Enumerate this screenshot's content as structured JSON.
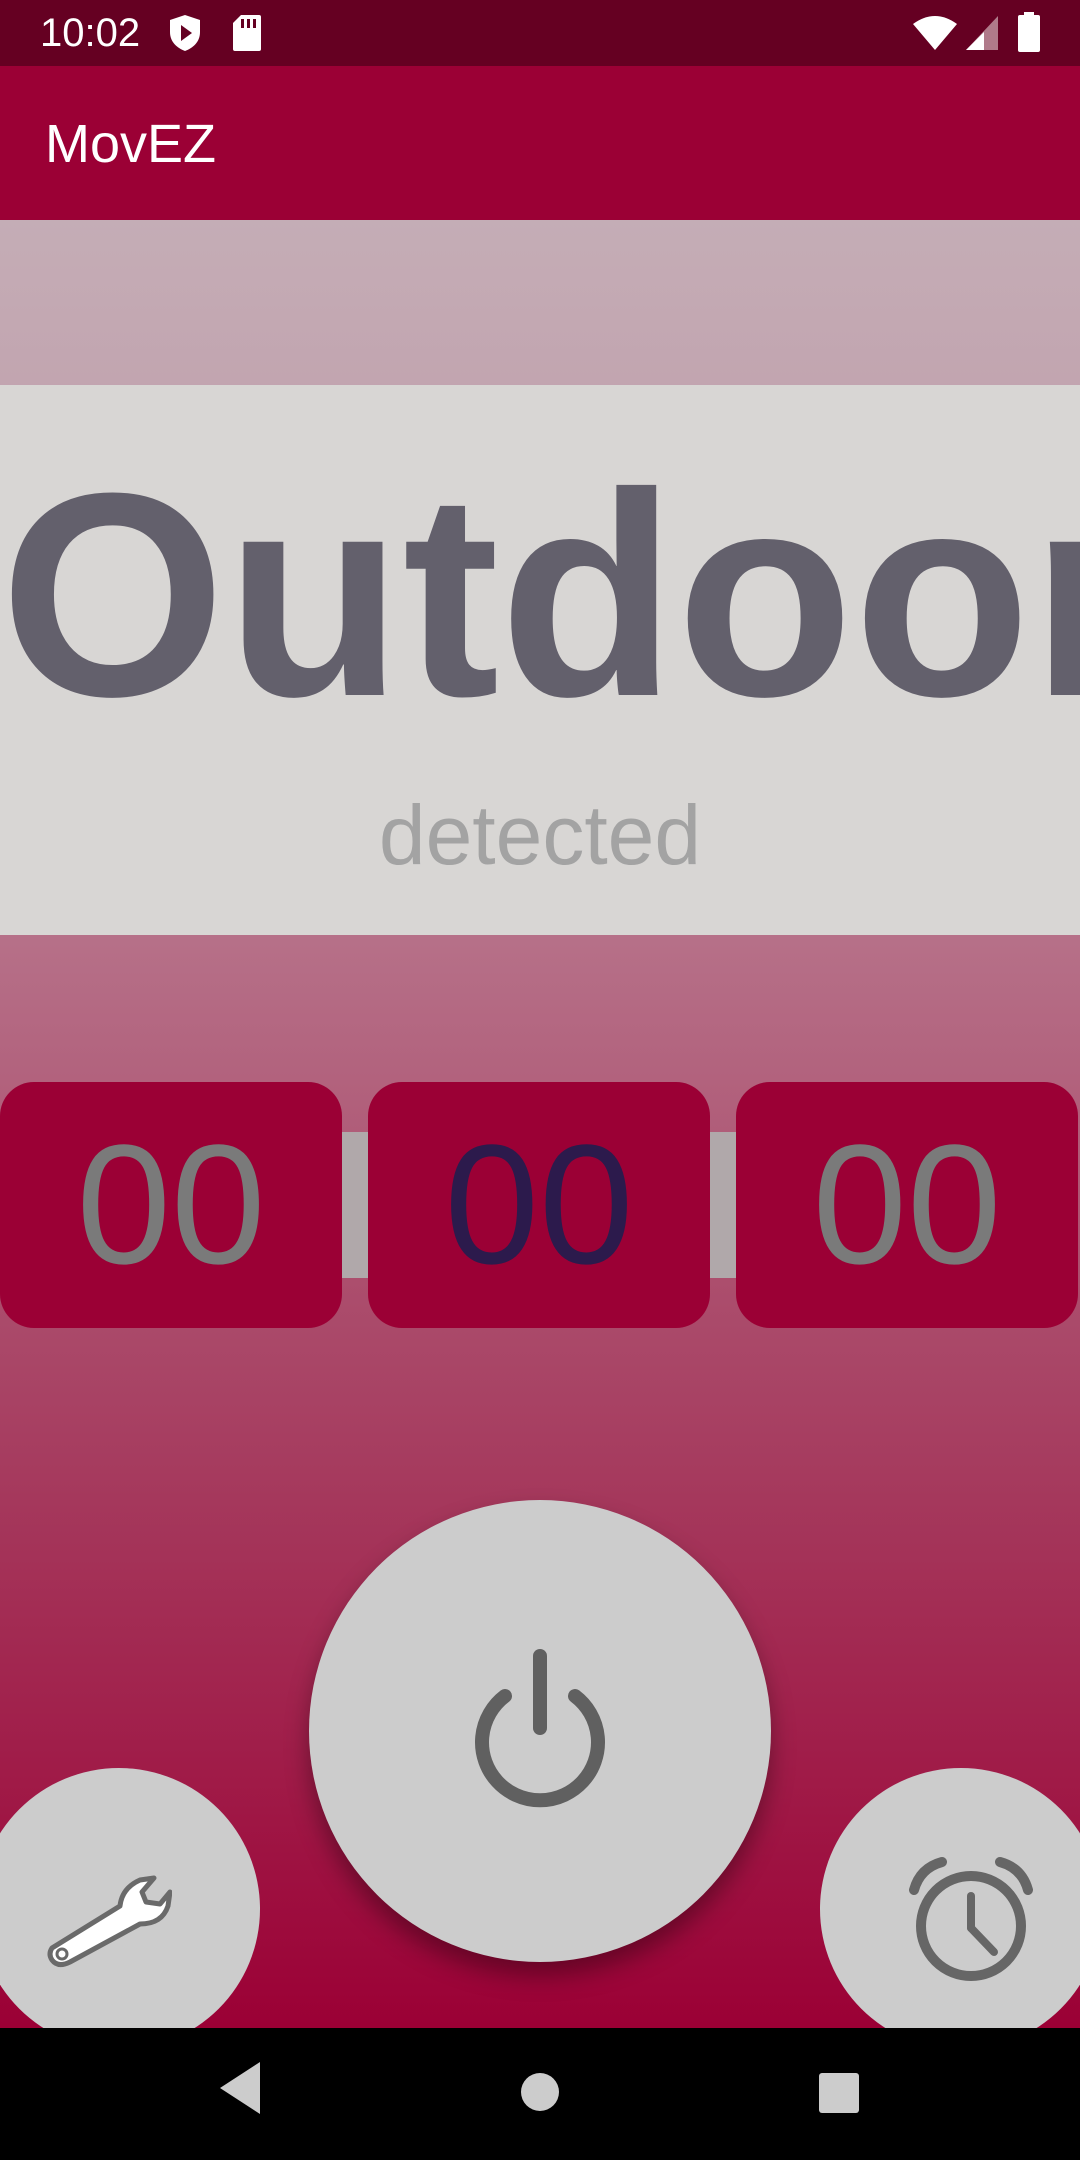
{
  "status_bar": {
    "time": "10:02",
    "icons": [
      "shield-play-icon",
      "sd-card-icon",
      "wifi-icon",
      "signal-icon",
      "battery-icon"
    ]
  },
  "app_bar": {
    "title": "MovEZ",
    "color": "#9b0035"
  },
  "detection": {
    "mode": "Outdoor",
    "status": "detected"
  },
  "timer": {
    "hours": "00",
    "minutes": "00",
    "seconds": "00"
  },
  "controls": {
    "power_icon": "power-icon",
    "settings_icon": "wrench-icon",
    "alarm_icon": "alarm-clock-icon"
  },
  "nav_bar": {
    "icons": [
      "back-icon",
      "home-icon",
      "recents-icon"
    ]
  },
  "colors": {
    "primary": "#9b0035",
    "primary_dark": "#650022",
    "panel": "#d8d6d4",
    "mode_text": "#63606c",
    "button": "#cccccc"
  }
}
